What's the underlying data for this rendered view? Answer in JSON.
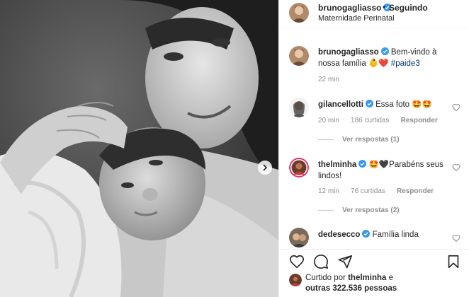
{
  "post": {
    "username": "brunogagliasso",
    "follow_dot": "•",
    "follow_label": "Seguindo",
    "location": "Maternidade Perinatal"
  },
  "caption": {
    "username": "brunogagliasso",
    "text": "Bem-vindo à nossa família 👶❤️",
    "hashtag": "#paide3",
    "time": "22 min"
  },
  "comments": [
    {
      "username": "gilancellotti",
      "text": "Essa foto 🤩🤩",
      "time": "20 min",
      "likes": "186 curtidas",
      "reply": "Responder",
      "view_replies": "Ver respostas (1)"
    },
    {
      "username": "thelminha",
      "text": "🤩🖤Parabéns seus lindos!",
      "time": "12 min",
      "likes": "76 curtidas",
      "reply": "Responder",
      "view_replies": "Ver respostas (2)"
    },
    {
      "username": "dedesecco",
      "text": "Família linda"
    }
  ],
  "likes": {
    "prefix": "Curtido por",
    "user": "thelminha",
    "connector": "e",
    "others": "outras 322.536 pessoas"
  },
  "icons": {
    "like": "heart-icon",
    "comment": "comment-bubble-icon",
    "share": "paper-plane-icon",
    "save": "bookmark-icon",
    "next": "chevron-right-icon",
    "verified": "verified-badge-icon"
  },
  "colors": {
    "verified": "#3897f0",
    "hashtag": "#00376b",
    "muted": "#8e8e8e"
  }
}
